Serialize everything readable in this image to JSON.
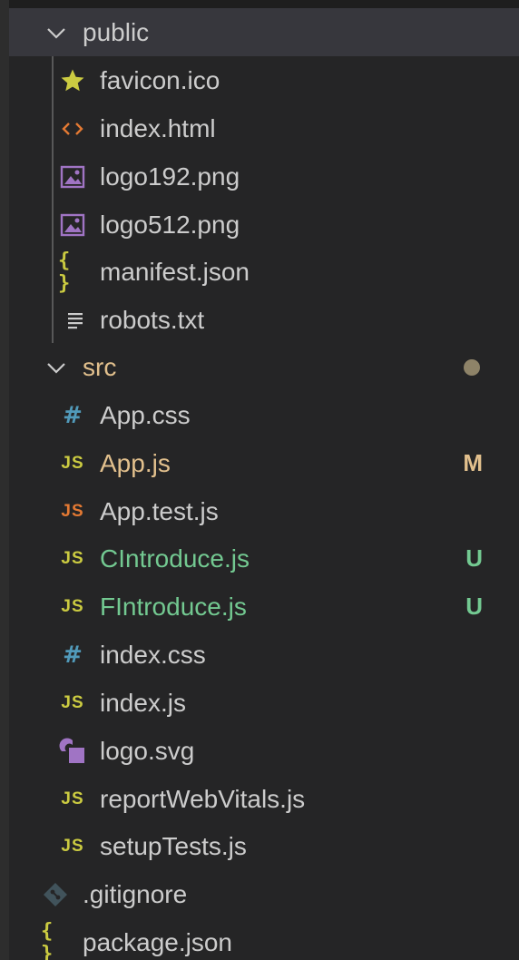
{
  "colors": {
    "background": "#252526",
    "selected_row": "#37373d",
    "text_default": "#cccccc",
    "text_modified": "#e2c08d",
    "text_untracked": "#73c991",
    "js_yellow": "#cbcb41",
    "js_orange": "#e37933",
    "css_blue": "#519aba",
    "html_orange": "#e37933",
    "image_purple": "#a074c4",
    "star_yellow": "#cbcb41",
    "git_gray": "#41535b",
    "modified_dot": "#8e8368"
  },
  "tree": {
    "public": {
      "label": "public",
      "icon": "chevron-down-icon",
      "children": [
        {
          "label": "favicon.ico",
          "icon": "star-icon"
        },
        {
          "label": "index.html",
          "icon": "html-icon"
        },
        {
          "label": "logo192.png",
          "icon": "image-icon"
        },
        {
          "label": "logo512.png",
          "icon": "image-icon"
        },
        {
          "label": "manifest.json",
          "icon": "json-icon"
        },
        {
          "label": "robots.txt",
          "icon": "text-file-icon"
        }
      ]
    },
    "src": {
      "label": "src",
      "icon": "chevron-down-icon",
      "children": [
        {
          "label": "App.css",
          "icon": "css-icon",
          "status": ""
        },
        {
          "label": "App.js",
          "icon": "js-icon",
          "status": "M"
        },
        {
          "label": "App.test.js",
          "icon": "js-test-icon",
          "status": ""
        },
        {
          "label": "CIntroduce.js",
          "icon": "js-icon",
          "status": "U"
        },
        {
          "label": "FIntroduce.js",
          "icon": "js-icon",
          "status": "U"
        },
        {
          "label": "index.css",
          "icon": "css-icon",
          "status": ""
        },
        {
          "label": "index.js",
          "icon": "js-icon",
          "status": ""
        },
        {
          "label": "logo.svg",
          "icon": "svg-icon",
          "status": ""
        },
        {
          "label": "reportWebVitals.js",
          "icon": "js-icon",
          "status": ""
        },
        {
          "label": "setupTests.js",
          "icon": "js-icon",
          "status": ""
        }
      ]
    },
    "root_files": [
      {
        "label": ".gitignore",
        "icon": "git-icon"
      },
      {
        "label": "package.json",
        "icon": "json-icon"
      }
    ],
    "js_glyph": "JS",
    "css_glyph": "#",
    "json_glyph": "{ }",
    "html_glyph": "<>"
  }
}
